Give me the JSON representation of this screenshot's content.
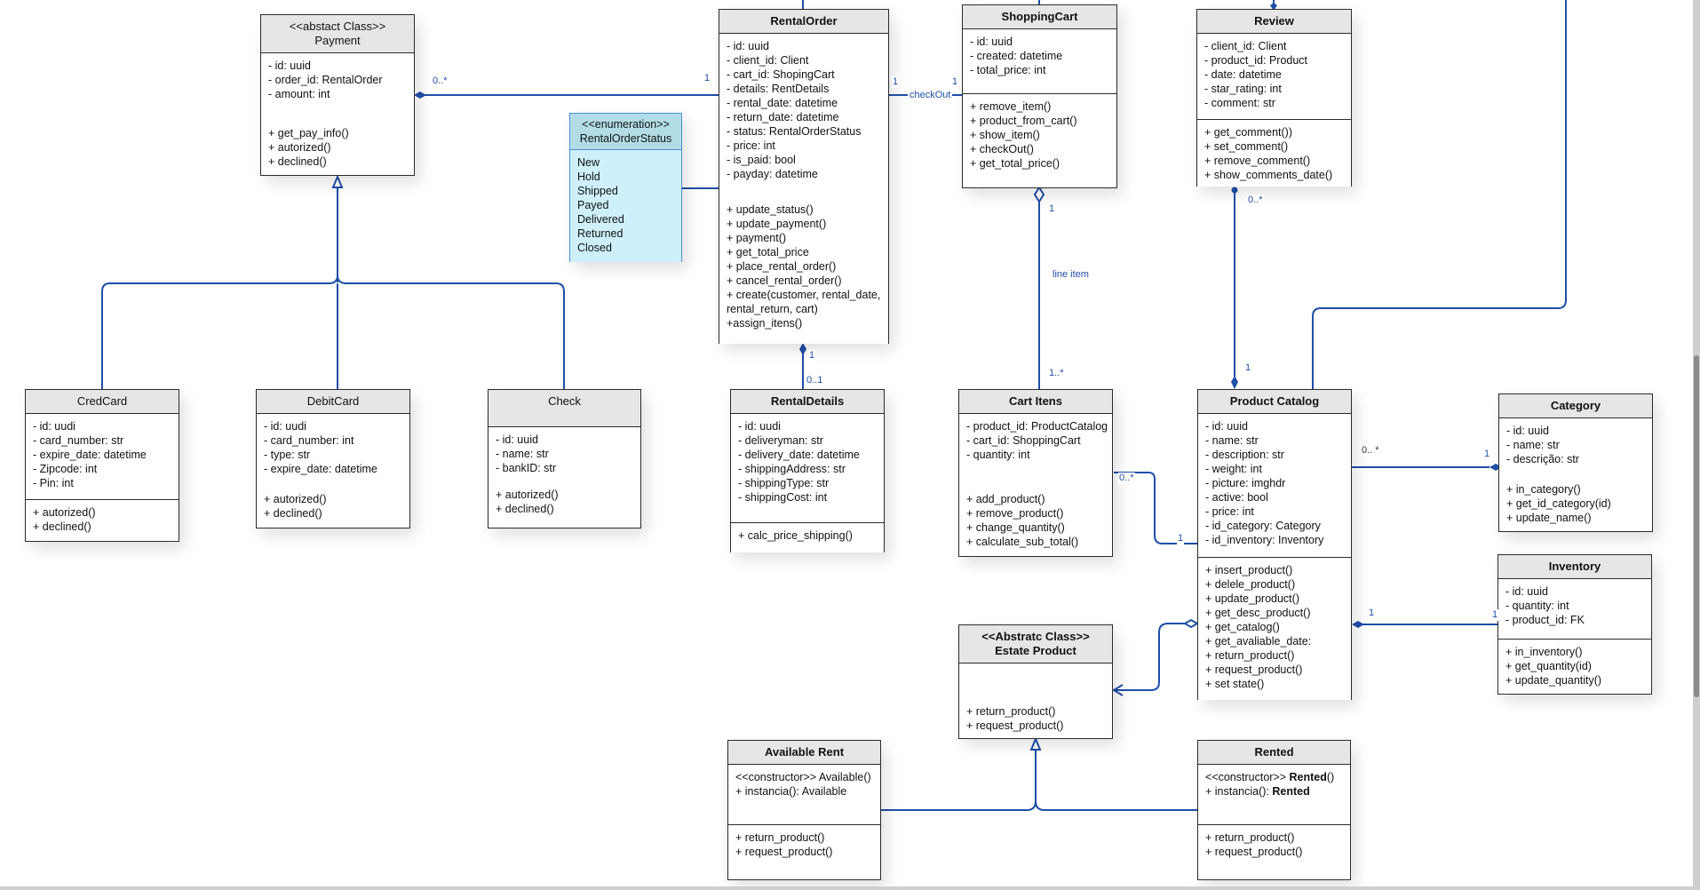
{
  "diagram": {
    "type": "UML class diagram",
    "line_color": "#1f4fa8",
    "enum_fill": "#cdf0fb",
    "header_fill": "#e6e6e6"
  },
  "classes": {
    "payment": {
      "stereotype": "<<abstact Class>>",
      "name": "Payment",
      "attributes": [
        "- id: uuid",
        "- order_id: RentalOrder",
        "- amount: int"
      ],
      "methods": [
        "+ get_pay_info()",
        "+ autorized()",
        "+ declined()"
      ]
    },
    "rental_order": {
      "name": "RentalOrder",
      "attributes": [
        "- id: uuid",
        "- client_id: Client",
        "- cart_id: ShopingCart",
        "- details: RentDetails",
        "- rental_date: datetime",
        "- return_date: datetime",
        "- status: RentalOrderStatus",
        "- price: int",
        "- is_paid: bool",
        "- payday: datetime"
      ],
      "methods": [
        "+ update_status()",
        "+ update_payment()",
        "+ payment()",
        "+ get_total_price",
        "+ place_rental_order()",
        "+ cancel_rental_order()",
        "+ create(customer, rental_date,",
        "rental_return, cart)",
        "+assign_itens()"
      ]
    },
    "rental_order_status": {
      "stereotype": "<<enumeration>>",
      "name": "RentalOrderStatus",
      "values": [
        "New",
        "Hold",
        "Shipped",
        "Payed",
        "Delivered",
        "Returned",
        "Closed"
      ]
    },
    "shopping_cart": {
      "name": "ShoppingCart",
      "attributes": [
        "- id: uuid",
        "- created: datetime",
        "- total_price: int"
      ],
      "methods": [
        "+ remove_item()",
        "+ product_from_cart()",
        "+ show_item()",
        "+ checkOut()",
        "+ get_total_price()"
      ]
    },
    "review": {
      "name": "Review",
      "attributes": [
        "- client_id: Client",
        "- product_id: Product",
        "- date: datetime",
        "- star_rating: int",
        "- comment: str"
      ],
      "methods": [
        "+ get_comment())",
        "+ set_comment()",
        "+ remove_comment()",
        "+ show_comments_date()"
      ]
    },
    "cred_card": {
      "name": "CredCard",
      "attributes": [
        "- id: uudi",
        "- card_number: str",
        "- expire_date: datetime",
        "- Zipcode: int",
        "- Pin: int"
      ],
      "methods": [
        "+ autorized()",
        "+ declined()"
      ]
    },
    "debit_card": {
      "name": "DebitCard",
      "attributes": [
        "- id: uudi",
        "- card_number: int",
        "- type: str",
        "- expire_date: datetime"
      ],
      "methods": [
        "+ autorized()",
        "+ declined()"
      ]
    },
    "check": {
      "name": "Check",
      "attributes": [
        "- id: uuid",
        "- name: str",
        "- bankID: str"
      ],
      "methods": [
        "+ autorized()",
        "+ declined()"
      ]
    },
    "rental_details": {
      "name": "RentalDetails",
      "attributes": [
        "- id: uudi",
        "- deliveryman: str",
        "- delivery_date: datetime",
        "- shippingAddress: str",
        "- shippingType: str",
        "- shippingCost: int"
      ],
      "methods": [
        "+ calc_price_shipping()"
      ]
    },
    "cart_itens": {
      "name": "Cart Itens",
      "attributes": [
        "- product_id: ProductCatalog",
        "- cart_id: ShoppingCart",
        "- quantity: int"
      ],
      "methods": [
        "+ add_product()",
        "+ remove_product()",
        "+ change_quantity()",
        "+ calculate_sub_total()"
      ]
    },
    "product_catalog": {
      "name": "Product Catalog",
      "attributes": [
        "- id: uuid",
        "- name: str",
        "- description: str",
        "- weight: int",
        "- picture: imghdr",
        "- active: bool",
        "- price: int",
        "- id_category: Category",
        "- id_inventory: Inventory"
      ],
      "methods": [
        "+ insert_product()",
        "+ delele_product()",
        "+ update_product()",
        "+ get_desc_product()",
        "+ get_catalog()",
        "+ get_avaliable_date:",
        "+ return_product()",
        "+ request_product()",
        "+ set state()"
      ]
    },
    "category": {
      "name": "Category",
      "attributes": [
        "- id: uuid",
        "- name: str",
        "- descrição: str"
      ],
      "methods": [
        "+ in_category()",
        "+ get_id_category(id)",
        "+ update_name()"
      ]
    },
    "inventory": {
      "name": "Inventory",
      "attributes": [
        "- id: uuid",
        "- quantity: int",
        "- product_id: FK"
      ],
      "methods": [
        "+ in_inventory()",
        "+ get_quantity(id)",
        "+ update_quantity()"
      ]
    },
    "estate_product": {
      "stereotype": "<<Abstratc Class>>",
      "name": "Estate Product",
      "methods": [
        "+ return_product()",
        "+ request_product()"
      ]
    },
    "available_rent": {
      "name": "Available Rent",
      "constructor_prefix": "<<constructor>> ",
      "constructor_name": "Available()",
      "instance_prefix": "+ instancia(): ",
      "instance_type": "Available",
      "methods": [
        "+ return_product()",
        "+ request_product()"
      ]
    },
    "rented": {
      "name": "Rented",
      "constructor_prefix": "<<constructor>> ",
      "constructor_name": "Rented",
      "constructor_suffix": "()",
      "instance_prefix": "+ instancia(): ",
      "instance_type": "Rented",
      "methods": [
        "+ return_product()",
        "+ request_product()"
      ]
    }
  },
  "labels": {
    "payment_many": "0..*",
    "order_payment_one": "1",
    "order_cart_one_a": "1",
    "order_cart_one_b": "1",
    "checkout": "checkOut",
    "cart_one": "1",
    "line_item": "line item",
    "cart_items_many": "1..*",
    "order_details_one": "1",
    "details_zero_one": "0..1",
    "review_many": "0..*",
    "catalog_review_one": "1",
    "cartitem_catalog_many": "0..*",
    "cartitem_catalog_one": "1",
    "catalog_category_many": "0.. *",
    "category_one": "1",
    "catalog_inventory_one_a": "1",
    "catalog_inventory_one_b": "1"
  }
}
